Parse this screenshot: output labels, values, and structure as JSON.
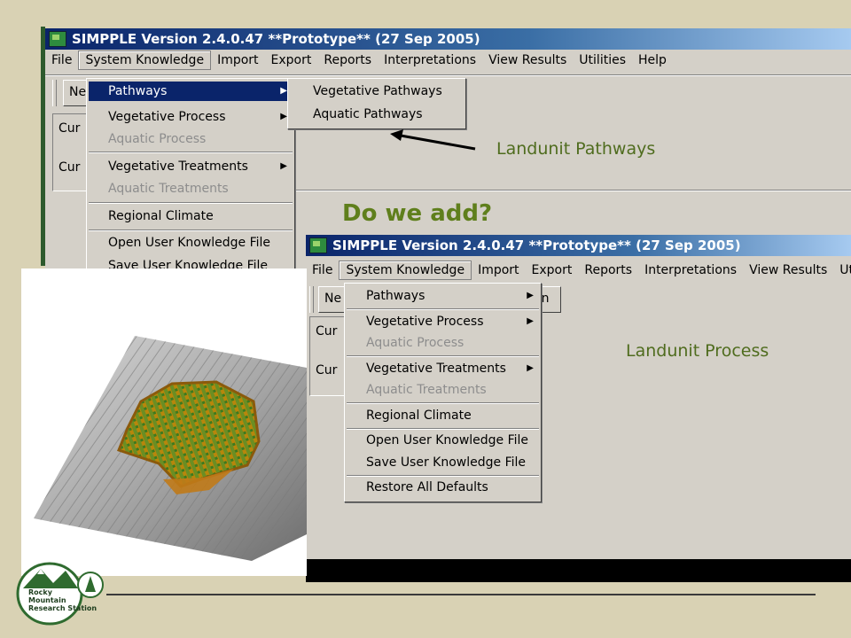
{
  "app_title": "SIMPPLE Version 2.4.0.47 **Prototype** (27 Sep 2005)",
  "menu_top": [
    "File",
    "System Knowledge",
    "Import",
    "Export",
    "Reports",
    "Interpretations",
    "View Results",
    "Utilities",
    "Help"
  ],
  "menu_bottom": [
    "File",
    "System Knowledge",
    "Import",
    "Export",
    "Reports",
    "Interpretations",
    "View Results",
    "Utiliti"
  ],
  "win1": {
    "toolbar_partial": "Ne",
    "panel_labels": [
      "Cur",
      "Cur"
    ],
    "dropdown": {
      "pathways": "Pathways",
      "vegetative_process": "Vegetative Process",
      "aquatic_process": "Aquatic Process",
      "vegetative_treatments": "Vegetative Treatments",
      "aquatic_treatments": "Aquatic Treatments",
      "regional_climate": "Regional Climate",
      "open_user_knowledge": "Open User Knowledge File",
      "save_user_knowledge": "Save User Knowledge File"
    },
    "submenu": {
      "vegetative_pathways": "Vegetative Pathways",
      "aquatic_pathways": "Aquatic Pathways"
    }
  },
  "win2": {
    "toolbar_partial": "Ne",
    "toolbar_partial_right": "on",
    "panel_labels": [
      "Cur",
      "Cur"
    ],
    "dropdown": {
      "pathways": "Pathways",
      "vegetative_process": "Vegetative Process",
      "aquatic_process": "Aquatic Process",
      "vegetative_treatments": "Vegetative Treatments",
      "aquatic_treatments": "Aquatic Treatments",
      "regional_climate": "Regional Climate",
      "open_user_knowledge": "Open User Knowledge File",
      "save_user_knowledge": "Save User Knowledge File",
      "restore_defaults": "Restore All Defaults"
    }
  },
  "callouts": {
    "landunit_pathways": "Landunit Pathways",
    "landunit_process": "Landunit Process",
    "question": "Do we add?"
  },
  "logo": {
    "line1": "Rocky",
    "line2": "Mountain",
    "line3": "Research Station"
  },
  "colors": {
    "background": "#d9d2b4",
    "accent_green": "#5f7f1c",
    "menu_highlight": "#0a246a"
  }
}
